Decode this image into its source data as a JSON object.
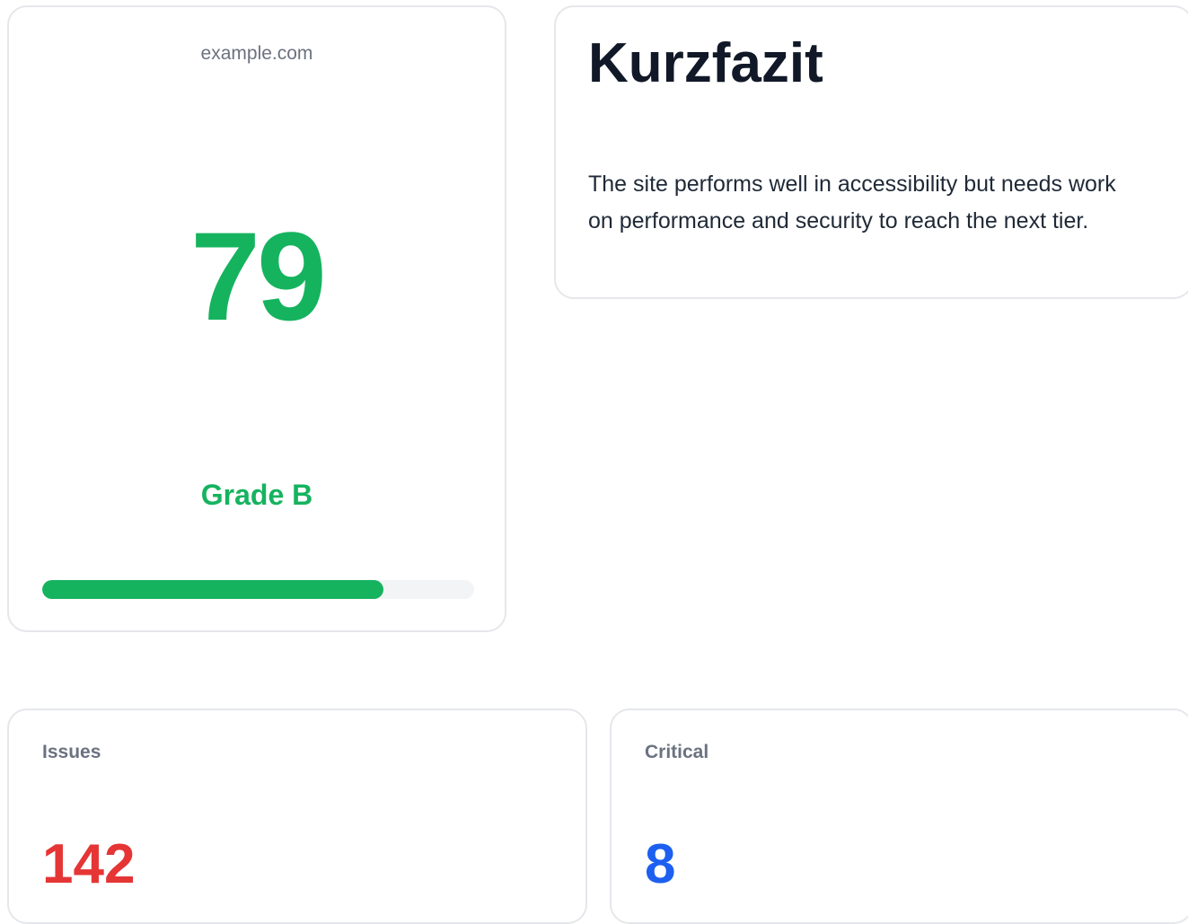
{
  "score_card": {
    "domain": "example.com",
    "score": "79",
    "grade_label": "Grade B",
    "progress_percent": 79,
    "accent_color": "#16b35f"
  },
  "summary": {
    "title": "Kurzfazit",
    "text": "The site performs well in accessibility but needs work on performance and security to reach the next tier."
  },
  "stats": {
    "issues": {
      "label": "Issues",
      "value": "142",
      "color": "#e53535"
    },
    "critical": {
      "label": "Critical",
      "value": "8",
      "color": "#1d5ff0"
    }
  }
}
